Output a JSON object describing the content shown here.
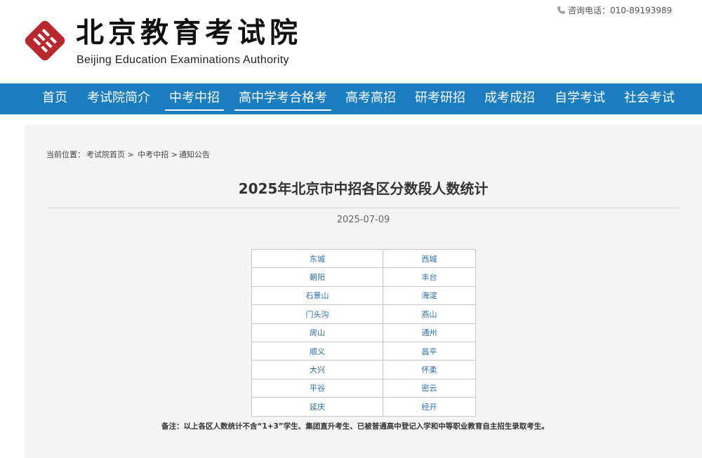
{
  "header": {
    "title_cn": "北京教育考试院",
    "title_en": "Beijing Education Examinations Authority",
    "phone_label": "咨询电话：010-89193989",
    "logo_color": "#b8282e"
  },
  "nav": {
    "items": [
      {
        "label": "首页",
        "active": false
      },
      {
        "label": "考试院简介",
        "active": false
      },
      {
        "label": "中考中招",
        "active": true
      },
      {
        "label": "高中学考合格考",
        "active": true
      },
      {
        "label": "高考高招",
        "active": false
      },
      {
        "label": "研考研招",
        "active": false
      },
      {
        "label": "成考成招",
        "active": false
      },
      {
        "label": "自学考试",
        "active": false
      },
      {
        "label": "社会考试",
        "active": false
      }
    ],
    "background": "#1a7dbf"
  },
  "breadcrumb": {
    "prefix": "当前位置：",
    "items": [
      "考试院首页",
      "中考中招",
      "通知公告"
    ],
    "separator": ">"
  },
  "article": {
    "title": "2025年北京市中招各区分数段人数统计",
    "date": "2025-07-09",
    "districts": [
      [
        "东城",
        "西城"
      ],
      [
        "朝阳",
        "丰台"
      ],
      [
        "石景山",
        "海淀"
      ],
      [
        "门头沟",
        "燕山"
      ],
      [
        "房山",
        "通州"
      ],
      [
        "顺义",
        "昌平"
      ],
      [
        "大兴",
        "怀柔"
      ],
      [
        "平谷",
        "密云"
      ],
      [
        "延庆",
        "经开"
      ]
    ],
    "note": "备注：以上各区人数统计不含“1+3”学生、集团直升考生、已被普通高中登记入学和中等职业教育自主招生录取考生。"
  }
}
